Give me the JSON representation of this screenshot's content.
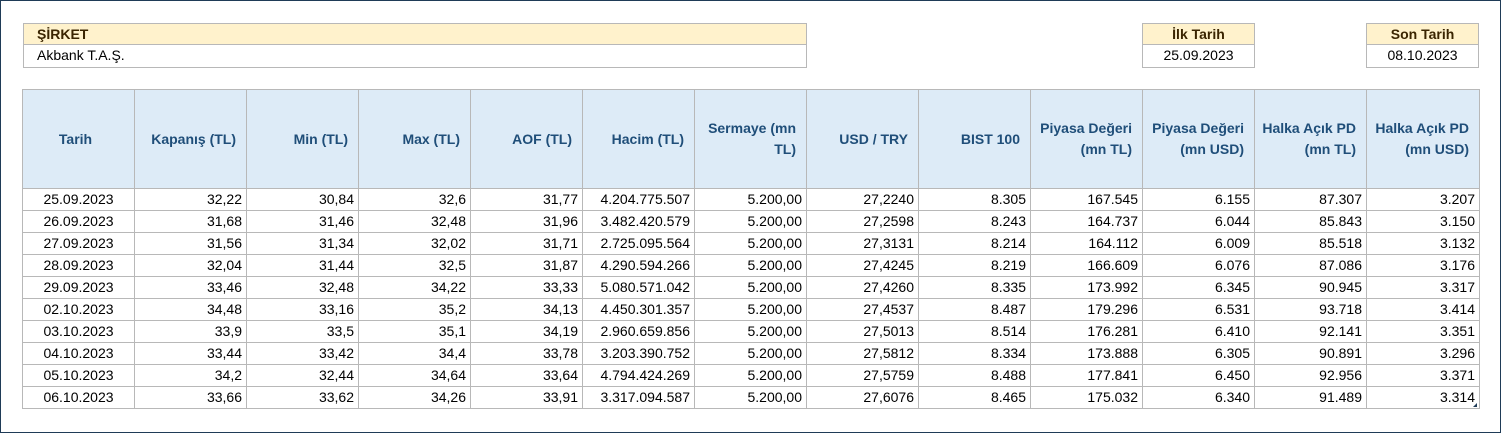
{
  "company": {
    "label": "ŞİRKET",
    "name": "Akbank T.A.Ş."
  },
  "first_date": {
    "label": "İlk Tarih",
    "value": "25.09.2023"
  },
  "last_date": {
    "label": "Son Tarih",
    "value": "08.10.2023"
  },
  "table": {
    "headers": [
      "Tarih",
      "Kapanış (TL)",
      "Min (TL)",
      "Max (TL)",
      "AOF (TL)",
      "Hacim (TL)",
      "Sermaye (mn TL)",
      "USD / TRY",
      "BIST 100",
      "Piyasa Değeri (mn TL)",
      "Piyasa Değeri (mn USD)",
      "Halka Açık PD (mn TL)",
      "Halka Açık PD (mn USD)"
    ],
    "rows": [
      [
        "25.09.2023",
        "32,22",
        "30,84",
        "32,6",
        "31,77",
        "4.204.775.507",
        "5.200,00",
        "27,2240",
        "8.305",
        "167.545",
        "6.155",
        "87.307",
        "3.207"
      ],
      [
        "26.09.2023",
        "31,68",
        "31,46",
        "32,48",
        "31,96",
        "3.482.420.579",
        "5.200,00",
        "27,2598",
        "8.243",
        "164.737",
        "6.044",
        "85.843",
        "3.150"
      ],
      [
        "27.09.2023",
        "31,56",
        "31,34",
        "32,02",
        "31,71",
        "2.725.095.564",
        "5.200,00",
        "27,3131",
        "8.214",
        "164.112",
        "6.009",
        "85.518",
        "3.132"
      ],
      [
        "28.09.2023",
        "32,04",
        "31,44",
        "32,5",
        "31,87",
        "4.290.594.266",
        "5.200,00",
        "27,4245",
        "8.219",
        "166.609",
        "6.076",
        "87.086",
        "3.176"
      ],
      [
        "29.09.2023",
        "33,46",
        "32,48",
        "34,22",
        "33,33",
        "5.080.571.042",
        "5.200,00",
        "27,4260",
        "8.335",
        "173.992",
        "6.345",
        "90.945",
        "3.317"
      ],
      [
        "02.10.2023",
        "34,48",
        "33,16",
        "35,2",
        "34,13",
        "4.450.301.357",
        "5.200,00",
        "27,4537",
        "8.487",
        "179.296",
        "6.531",
        "93.718",
        "3.414"
      ],
      [
        "03.10.2023",
        "33,9",
        "33,5",
        "35,1",
        "34,19",
        "2.960.659.856",
        "5.200,00",
        "27,5013",
        "8.514",
        "176.281",
        "6.410",
        "92.141",
        "3.351"
      ],
      [
        "04.10.2023",
        "33,44",
        "33,42",
        "34,4",
        "33,78",
        "3.203.390.752",
        "5.200,00",
        "27,5812",
        "8.334",
        "173.888",
        "6.305",
        "90.891",
        "3.296"
      ],
      [
        "05.10.2023",
        "34,2",
        "32,44",
        "34,64",
        "33,64",
        "4.794.424.269",
        "5.200,00",
        "27,5759",
        "8.488",
        "177.841",
        "6.450",
        "92.956",
        "3.371"
      ],
      [
        "06.10.2023",
        "33,66",
        "33,62",
        "34,26",
        "33,91",
        "3.317.094.587",
        "5.200,00",
        "27,6076",
        "8.465",
        "175.032",
        "6.340",
        "91.489",
        "3.314"
      ]
    ]
  }
}
